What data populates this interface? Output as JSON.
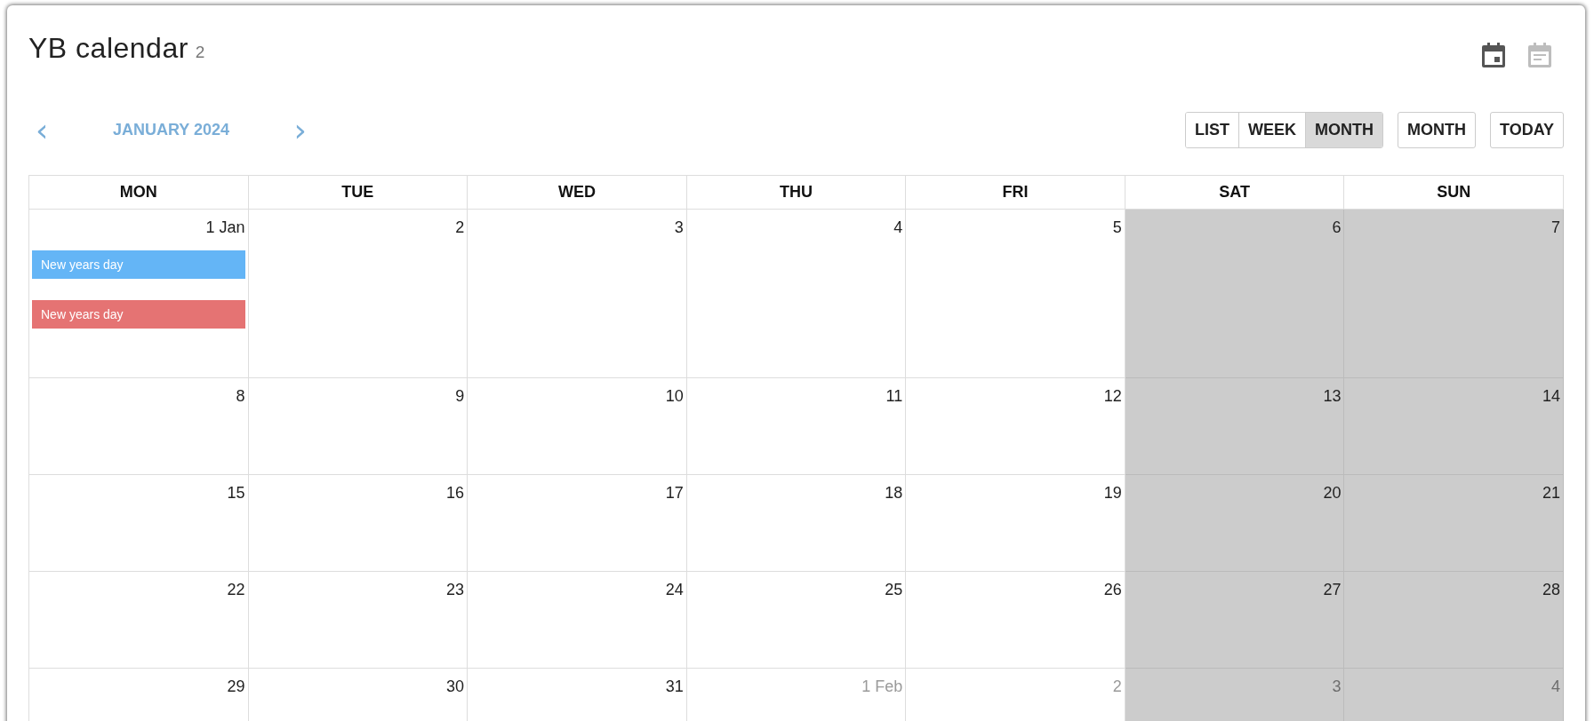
{
  "header": {
    "title": "YB calendar",
    "count": "2",
    "view_icons": [
      {
        "kind": "calendar",
        "selected": true
      },
      {
        "kind": "agenda",
        "selected": false
      }
    ]
  },
  "nav": {
    "prev": "‹",
    "month": "JANUARY 2024",
    "next": "›"
  },
  "view_toggle": [
    {
      "label": "LIST",
      "selected": false
    },
    {
      "label": "WEEK",
      "selected": false
    },
    {
      "label": "MONTH",
      "selected": true
    }
  ],
  "buttons": [
    "MONTH",
    "TODAY"
  ],
  "weekdays": [
    "MON",
    "TUE",
    "WED",
    "THU",
    "FRI",
    "SAT",
    "SUN"
  ],
  "weeks": [
    {
      "days": [
        {
          "label": "1 Jan",
          "weekend": false,
          "other_month": false,
          "events": [
            {
              "title": "New years day",
              "color": "#64b5f6"
            },
            {
              "title": "New years day",
              "color": "#e57373"
            }
          ]
        },
        {
          "label": "2",
          "weekend": false,
          "other_month": false
        },
        {
          "label": "3",
          "weekend": false,
          "other_month": false
        },
        {
          "label": "4",
          "weekend": false,
          "other_month": false
        },
        {
          "label": "5",
          "weekend": false,
          "other_month": false
        },
        {
          "label": "6",
          "weekend": true,
          "other_month": false
        },
        {
          "label": "7",
          "weekend": true,
          "other_month": false
        }
      ]
    },
    {
      "days": [
        {
          "label": "8",
          "weekend": false,
          "other_month": false
        },
        {
          "label": "9",
          "weekend": false,
          "other_month": false
        },
        {
          "label": "10",
          "weekend": false,
          "other_month": false
        },
        {
          "label": "11",
          "weekend": false,
          "other_month": false
        },
        {
          "label": "12",
          "weekend": false,
          "other_month": false
        },
        {
          "label": "13",
          "weekend": true,
          "other_month": false
        },
        {
          "label": "14",
          "weekend": true,
          "other_month": false
        }
      ]
    },
    {
      "days": [
        {
          "label": "15",
          "weekend": false,
          "other_month": false
        },
        {
          "label": "16",
          "weekend": false,
          "other_month": false
        },
        {
          "label": "17",
          "weekend": false,
          "other_month": false
        },
        {
          "label": "18",
          "weekend": false,
          "other_month": false
        },
        {
          "label": "19",
          "weekend": false,
          "other_month": false
        },
        {
          "label": "20",
          "weekend": true,
          "other_month": false
        },
        {
          "label": "21",
          "weekend": true,
          "other_month": false
        }
      ]
    },
    {
      "days": [
        {
          "label": "22",
          "weekend": false,
          "other_month": false
        },
        {
          "label": "23",
          "weekend": false,
          "other_month": false
        },
        {
          "label": "24",
          "weekend": false,
          "other_month": false
        },
        {
          "label": "25",
          "weekend": false,
          "other_month": false
        },
        {
          "label": "26",
          "weekend": false,
          "other_month": false
        },
        {
          "label": "27",
          "weekend": true,
          "other_month": false
        },
        {
          "label": "28",
          "weekend": true,
          "other_month": false
        }
      ]
    },
    {
      "days": [
        {
          "label": "29",
          "weekend": false,
          "other_month": false
        },
        {
          "label": "30",
          "weekend": false,
          "other_month": false
        },
        {
          "label": "31",
          "weekend": false,
          "other_month": false
        },
        {
          "label": "1 Feb",
          "weekend": false,
          "other_month": true
        },
        {
          "label": "2",
          "weekend": false,
          "other_month": true
        },
        {
          "label": "3",
          "weekend": true,
          "other_month": true
        },
        {
          "label": "4",
          "weekend": true,
          "other_month": true
        }
      ]
    }
  ]
}
